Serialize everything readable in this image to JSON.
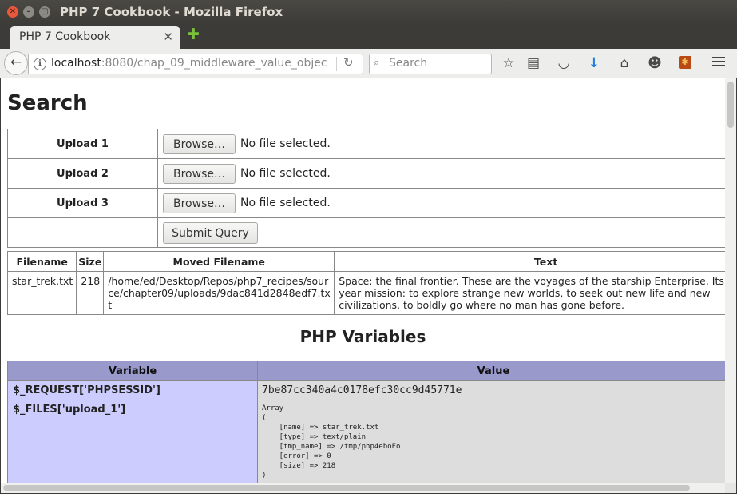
{
  "window": {
    "title": "PHP 7 Cookbook - Mozilla Firefox",
    "close_glyph": "✕",
    "minimize_glyph": "–",
    "maximize_glyph": "▢"
  },
  "tab": {
    "title": "PHP 7 Cookbook",
    "close_glyph": "✕",
    "new_tab_glyph": "✚"
  },
  "navbar": {
    "back_glyph": "←",
    "info_glyph": "i",
    "url_host": "localhost",
    "url_rest": ":8080/chap_09_middleware_value_objec",
    "reload_glyph": "↻",
    "search_placeholder": "Search",
    "search_glyph": "⌕",
    "toolbar_icons": [
      "star-icon",
      "reading-list-icon",
      "pocket-icon",
      "download-icon",
      "home-icon",
      "emoji-icon",
      "extension-icon",
      "menu-icon"
    ],
    "star_glyph": "☆",
    "reading_glyph": "▤",
    "pocket_glyph": "◡",
    "download_glyph": "↓",
    "home_glyph": "⌂",
    "emoji_glyph": "☻",
    "ext_glyph": "✱"
  },
  "page": {
    "heading": "Search",
    "uploads": [
      {
        "label": "Upload 1",
        "button": "Browse…",
        "status": "No file selected."
      },
      {
        "label": "Upload 2",
        "button": "Browse…",
        "status": "No file selected."
      },
      {
        "label": "Upload 3",
        "button": "Browse…",
        "status": "No file selected."
      }
    ],
    "submit_label": "Submit Query",
    "files_table": {
      "headers": [
        "Filename",
        "Size",
        "Moved Filename",
        "Text"
      ],
      "rows": [
        {
          "filename": "star_trek.txt",
          "size": "218",
          "moved": "/home/ed/Desktop/Repos/php7_recipes/source/chapter09/uploads/9dac841d2848edf7.txt",
          "text": "Space: the final frontier. These are the voyages of the starship Enterprise. Its five-year mission: to explore strange new worlds, to seek out new life and new civilizations, to boldly go where no man has gone before."
        }
      ]
    },
    "php_heading": "PHP Variables",
    "vars_table": {
      "headers": [
        "Variable",
        "Value"
      ],
      "rows": [
        {
          "variable": "$_REQUEST['PHPSESSID']",
          "value": "7be87cc340a4c0178efc30cc9d45771e"
        },
        {
          "variable": "$_FILES['upload_1']",
          "value": "Array\n(\n    [name] => star_trek.txt\n    [type] => text/plain\n    [tmp_name] => /tmp/php4eboFo\n    [error] => 0\n    [size] => 218\n)"
        }
      ]
    }
  },
  "colors": {
    "titlebar": "#3c3b37",
    "close_button": "#e9583b",
    "var_header": "#9999cc",
    "var_cell": "#ccccff",
    "value_cell": "#dddddd",
    "download_icon": "#1a7de0"
  }
}
